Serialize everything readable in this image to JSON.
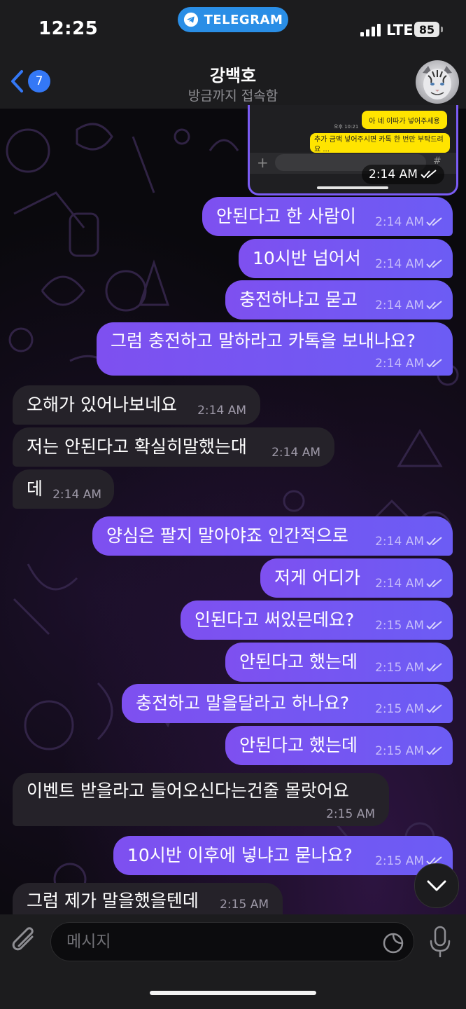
{
  "status_bar": {
    "time": "12:25",
    "app_pill": "TELEGRAM",
    "network": "LTE",
    "battery": "85"
  },
  "header": {
    "unread_count": "7",
    "name": "강백호",
    "status": "방금까지 접속함"
  },
  "media_message": {
    "bubble_1": "아 네 이따가 넣어주세용",
    "small_time": "오후 10:21",
    "bubble_2": "추가 금액 넣어주시면 카톡 한 번만 부탁드려요 ...",
    "time": "2:14 AM"
  },
  "messages": [
    {
      "dir": "out",
      "text": "안된다고 한 사람이",
      "time": "2:14 AM"
    },
    {
      "dir": "out",
      "text": "10시반 넘어서",
      "time": "2:14 AM"
    },
    {
      "dir": "out",
      "text": "충전하냐고 묻고",
      "time": "2:14 AM"
    },
    {
      "dir": "out",
      "text": "그럼 충전하고 말하라고 카톡을 보내나요?",
      "time": "2:14 AM"
    },
    {
      "dir": "in",
      "text": "오해가 있어나보네요",
      "time": "2:14 AM"
    },
    {
      "dir": "in",
      "text": "저는 안된다고 확실히말했는대",
      "time": "2:14 AM"
    },
    {
      "dir": "in",
      "text": "데",
      "time": "2:14 AM"
    },
    {
      "dir": "out",
      "text": "양심은 팔지 말아야죠 인간적으로",
      "time": "2:14 AM"
    },
    {
      "dir": "out",
      "text": "저게 어디가",
      "time": "2:14 AM"
    },
    {
      "dir": "out",
      "text": "인된다고 써있믄데요?",
      "time": "2:15 AM"
    },
    {
      "dir": "out",
      "text": "안된다고 했는데",
      "time": "2:15 AM"
    },
    {
      "dir": "out",
      "text": "충전하고 말을달라고 하나요?",
      "time": "2:15 AM"
    },
    {
      "dir": "out",
      "text": "안된다고 했는데",
      "time": "2:15 AM"
    },
    {
      "dir": "in",
      "text": "이벤트 받을라고 들어오신다는건줄 몰랏어요",
      "time": "2:15 AM"
    },
    {
      "dir": "out",
      "text": "10시반 이후에 넣냐고 묻나요?",
      "time": "2:15 AM"
    },
    {
      "dir": "in",
      "text": "그럼 제가 말을했을텐데",
      "time": "2:15 AM"
    }
  ],
  "composer": {
    "placeholder": "메시지"
  },
  "colors": {
    "outgoing_bubble": "#7e50f0",
    "incoming_bubble": "#252229",
    "accent_blue": "#3478f6",
    "telegram_pill": "#2a8ee6"
  },
  "icons": [
    "telegram-plane-icon",
    "signal-icon",
    "back-chevron-icon",
    "attach-paperclip-icon",
    "sticker-icon",
    "mic-icon",
    "chevron-down-icon",
    "double-check-icon"
  ]
}
